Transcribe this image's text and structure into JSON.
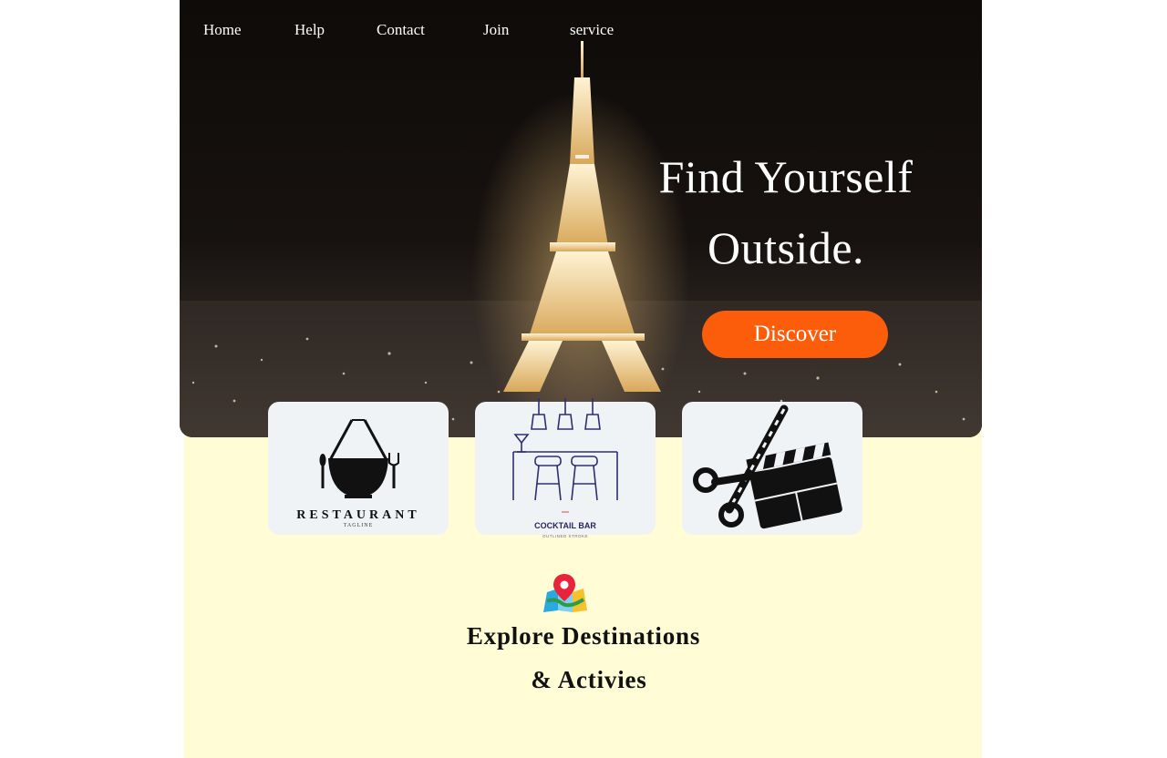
{
  "nav": {
    "items": [
      "Home",
      "Help",
      "Contact",
      "Join",
      "service"
    ]
  },
  "hero": {
    "headline_line1": "Find Yourself",
    "headline_line2": "Outside.",
    "cta_label": "Discover"
  },
  "cards": [
    {
      "icon": "restaurant-bowl-icon",
      "title": "RESTAURANT",
      "subtitle": "TAGLINE"
    },
    {
      "icon": "cocktail-bar-icon",
      "title": "COCKTAIL BAR",
      "subtitle": "OUTLINED STROKE"
    },
    {
      "icon": "scissors-clapperboard-icon",
      "title": "",
      "subtitle": ""
    }
  ],
  "explore": {
    "icon": "map-pin-icon",
    "line1": "Explore Destinations",
    "line2": "&  Activies"
  },
  "colors": {
    "accent": "#fb5d0b",
    "section_bg": "#fffcd6",
    "card_bg": "#f0f3f6",
    "hero_bg": "#0b0806"
  }
}
